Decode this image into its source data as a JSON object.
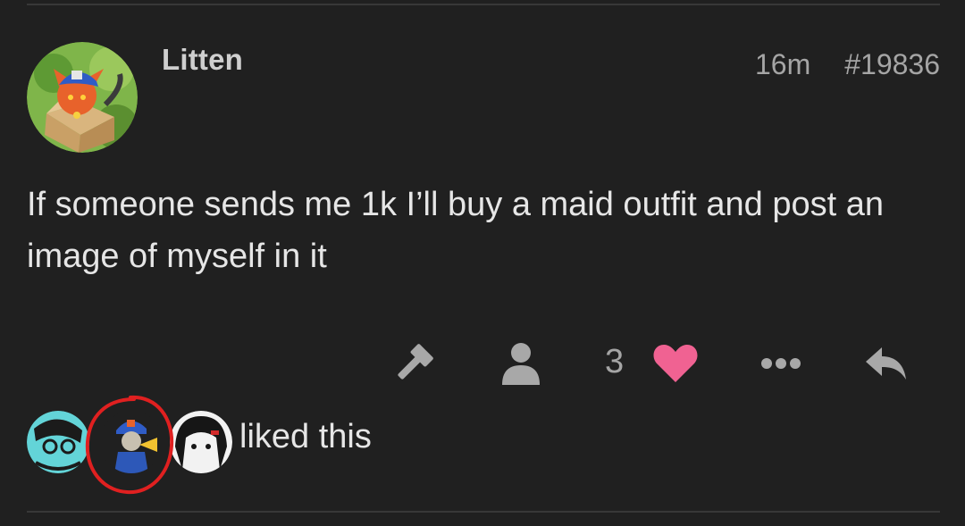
{
  "post": {
    "author": "Litten",
    "time": "16m",
    "post_number": "#19836",
    "body": "If someone sends me 1k I’ll buy a maid outfit and post an image of myself in it"
  },
  "actions": {
    "like_count": "3",
    "icons": [
      "hammer-icon",
      "user-icon",
      "heart-icon",
      "more-icon",
      "reply-icon"
    ]
  },
  "likers": {
    "text": "liked this",
    "count": 3
  },
  "colors": {
    "background": "#202020",
    "heart": "#f06292",
    "annotation": "#e02020",
    "text": "#e6e6e6",
    "muted": "#a5a5a5"
  }
}
